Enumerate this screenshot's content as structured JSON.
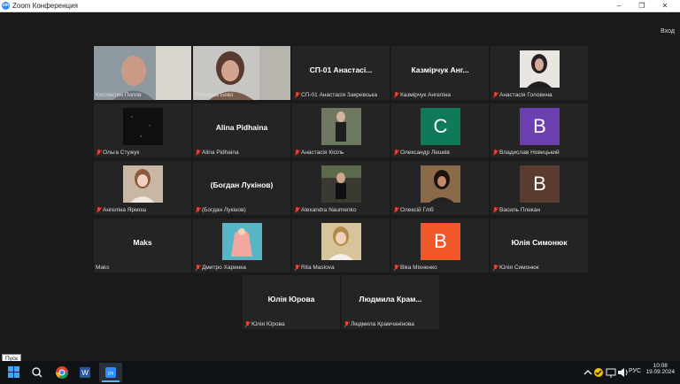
{
  "window": {
    "title": "Zoom Конференция",
    "app_icon": "zm",
    "minimize": "–",
    "restore": "❐",
    "close": "✕"
  },
  "top_right": {
    "login_label": "Вход"
  },
  "participants": [
    {
      "name": "Костянтин Попов",
      "muted": false,
      "video": true,
      "active": true
    },
    {
      "name": "Світлана Бевз",
      "muted": false,
      "video": true
    },
    {
      "name": "СП-01 Анастасія Закревська",
      "big": "СП-01 Анастасі...",
      "muted": true,
      "video": false
    },
    {
      "name": "Казмірчук Ангеліна",
      "big": "Казмірчук Анг...",
      "muted": true,
      "video": false
    },
    {
      "name": "Анастасія Головина",
      "muted": true,
      "video": false,
      "avatar_color": "#2a1e22"
    },
    {
      "name": "Ольга Стужук",
      "muted": true,
      "video": false,
      "avatar_color": "#0f0f12"
    },
    {
      "name": "Alina Pidhaina",
      "big": "Alina Pidhaina",
      "muted": true,
      "video": false
    },
    {
      "name": "Анастасія Кісіль",
      "muted": true,
      "video": false,
      "avatar_color": "#6e7860"
    },
    {
      "name": "Олександр Лешків",
      "muted": true,
      "video": false,
      "letter": "С",
      "letter_color": "#0f7a5a"
    },
    {
      "name": "Владислав Новицький",
      "muted": true,
      "video": false,
      "letter": "B",
      "letter_color": "#6b3fb0"
    },
    {
      "name": "Ангеліна Ярмош",
      "muted": true,
      "video": false,
      "avatar_color": "#c9b6a5"
    },
    {
      "name": "(Богдан Лукінов)",
      "big": "(Богдан Лукінов)",
      "muted": true,
      "video": false
    },
    {
      "name": "Alexandra Naumenko",
      "muted": true,
      "video": false,
      "avatar_color": "#3a3a32"
    },
    {
      "name": "Олексій Гліб",
      "muted": true,
      "video": false,
      "avatar_color": "#8a6a48"
    },
    {
      "name": "Василь Плекан",
      "muted": true,
      "video": false,
      "letter": "B",
      "letter_color": "#5b3a30"
    },
    {
      "name": "Maks",
      "big": "Maks",
      "muted": false,
      "video": false
    },
    {
      "name": "Дмитро Харинка",
      "muted": true,
      "video": false,
      "avatar_color": "#58b5c5"
    },
    {
      "name": "Rita Maslova",
      "muted": true,
      "video": false,
      "avatar_color": "#d8c49a"
    },
    {
      "name": "Віка Міхненко",
      "muted": true,
      "video": false,
      "letter": "B",
      "letter_color": "#f0582a"
    },
    {
      "name": "Юлія Симонюк",
      "big": "Юлія Симонюк",
      "muted": true,
      "video": false
    },
    {
      "name": "Юлія Юрова",
      "big": "Юлія Юрова",
      "muted": true,
      "video": false
    },
    {
      "name": "Людмила Крамчанінова",
      "big": "Людмила Крам...",
      "muted": true,
      "video": false
    }
  ],
  "taskbar": {
    "tooltip": "Пуск",
    "tray": {
      "language": "РУС",
      "time": "10:08",
      "date": "19.09.2024"
    },
    "apps": [
      "windows-start-icon",
      "search-icon",
      "chrome-icon",
      "word-icon",
      "zoom-icon"
    ]
  }
}
